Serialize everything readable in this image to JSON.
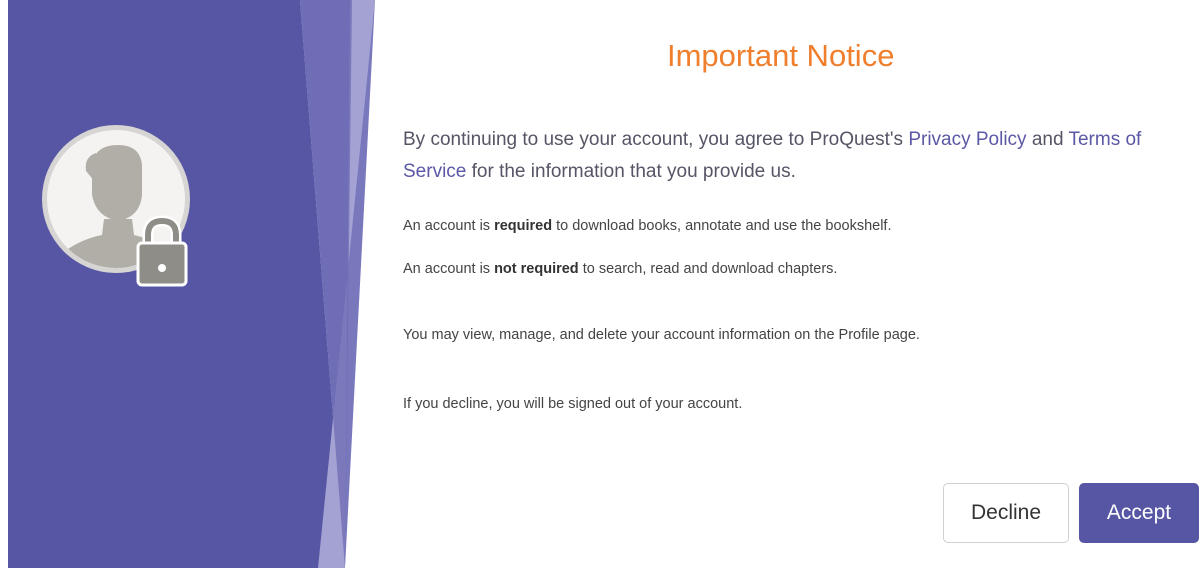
{
  "notice": {
    "title": "Important Notice",
    "intro_prefix": "By continuing to use your account, you agree to ProQuest's ",
    "privacy_link": "Privacy Policy",
    "intro_and": " and ",
    "terms_link": "Terms of Service",
    "intro_suffix": " for the information that you provide us.",
    "req_prefix": "An account is ",
    "req_bold": "required",
    "req_suffix": " to download books, annotate and use the bookshelf.",
    "notreq_prefix": "An account is ",
    "notreq_bold": "not required",
    "notreq_suffix": " to search, read and download chapters.",
    "profile_text": "You may view, manage, and delete your account information on the Profile page.",
    "decline_text": "If you decline, you will be signed out of your account."
  },
  "buttons": {
    "decline": "Decline",
    "accept": "Accept"
  },
  "icons": {
    "avatar": "user-silhouette-icon",
    "lock": "padlock-icon"
  },
  "colors": {
    "panel": "#5756a4",
    "title": "#f07f2d",
    "link": "#5b58a5",
    "accept": "#5756a4"
  }
}
